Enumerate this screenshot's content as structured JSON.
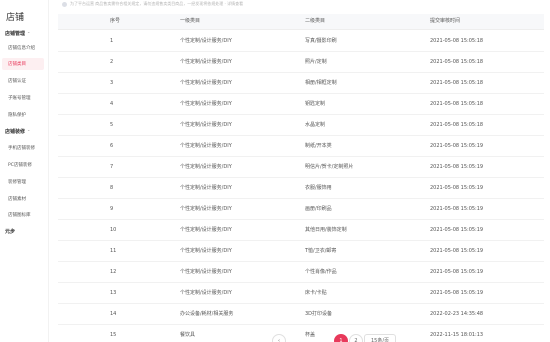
{
  "sidebar": {
    "brand": "店铺",
    "groups": [
      {
        "label": "店铺管理",
        "chevron": "⌃"
      },
      {
        "label": "店铺装修",
        "chevron": "⌃"
      },
      {
        "label": "元步"
      }
    ],
    "items": [
      {
        "label": "店铺信息介绍"
      },
      {
        "label": "店铺类目"
      },
      {
        "label": "店铺认证"
      },
      {
        "label": "子账号管理"
      },
      {
        "label": "隐私保护"
      },
      {
        "label": "手机店铺装修"
      },
      {
        "label": "PC店铺装修"
      },
      {
        "label": "装修管理"
      },
      {
        "label": "店铺素材"
      },
      {
        "label": "店铺图标库"
      }
    ]
  },
  "breadcrumb": {
    "text": "为了平台运营 商品售卖需符合相关规定，请勿违规售卖类目商品，一经发现将依规处理 · 详情查看",
    "icon": "info-icon"
  },
  "table": {
    "headers": [
      "序号",
      "一级类目",
      "二级类目",
      "提交审核时间"
    ],
    "rows": [
      [
        "1",
        "个性定制/设计服务/DIY",
        "写真/摄影印刷",
        "2021-05-08 15:05:18"
      ],
      [
        "2",
        "个性定制/设计服务/DIY",
        "照片/定制",
        "2021-05-08 15:05:18"
      ],
      [
        "3",
        "个性定制/设计服务/DIY",
        "相册/相框定制",
        "2021-05-08 15:05:18"
      ],
      [
        "4",
        "个性定制/设计服务/DIY",
        "钥匙定制",
        "2021-05-08 15:05:18"
      ],
      [
        "5",
        "个性定制/设计服务/DIY",
        "水晶定制",
        "2021-05-08 15:05:18"
      ],
      [
        "6",
        "个性定制/设计服务/DIY",
        "制纸/开本类",
        "2021-05-08 15:05:19"
      ],
      [
        "7",
        "个性定制/设计服务/DIY",
        "明信片/贺卡/定制照片",
        "2021-05-08 15:05:19"
      ],
      [
        "8",
        "个性定制/设计服务/DIY",
        "衣服/服饰用",
        "2021-05-08 15:05:19"
      ],
      [
        "9",
        "个性定制/设计服务/DIY",
        "画册/印刷品",
        "2021-05-08 15:05:19"
      ],
      [
        "10",
        "个性定制/设计服务/DIY",
        "其他日用/装饰定制",
        "2021-05-08 15:05:19"
      ],
      [
        "11",
        "个性定制/设计服务/DIY",
        "T恤/卫衣/邮寄",
        "2021-05-08 15:05:19"
      ],
      [
        "12",
        "个性定制/设计服务/DIY",
        "个性肖像/作品",
        "2021-05-08 15:05:19"
      ],
      [
        "13",
        "个性定制/设计服务/DIY",
        "床卡/卡贴",
        "2021-05-08 15:05:19"
      ],
      [
        "14",
        "办公设备/耗材/相关服务",
        "3D打印设备",
        "2022-02-23 14:35:48"
      ],
      [
        "15",
        "餐饮具",
        "杯盖",
        "2022-11-15 18:01:13"
      ]
    ]
  },
  "pagination": {
    "prev": "‹",
    "pages": [
      "1",
      "2"
    ],
    "active": "1",
    "next": "›",
    "page_size": "15条/页"
  },
  "colors": {
    "accent": "#e8395b",
    "header_bg": "#f7f8fa",
    "border": "#eeeeee"
  }
}
